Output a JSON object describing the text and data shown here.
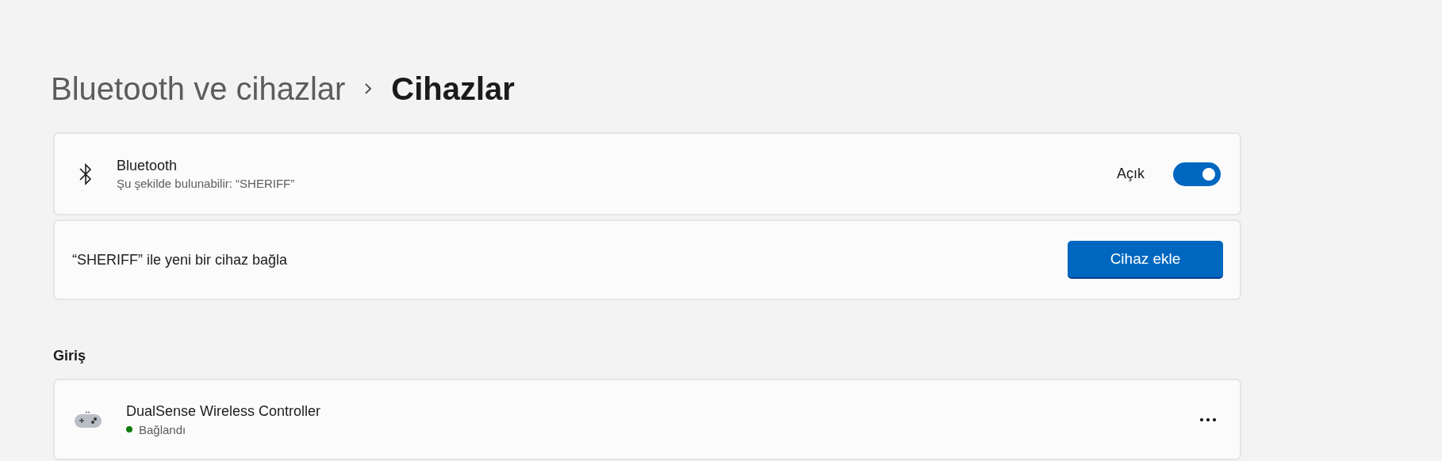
{
  "breadcrumb": [
    {
      "label": "Bluetooth ve cihazlar",
      "current": false
    },
    {
      "label": "Cihazlar",
      "current": true
    }
  ],
  "bluetooth": {
    "title": "Bluetooth",
    "subtitle": "Şu şekilde bulunabilir: “SHERIFF”",
    "state_label": "Açık",
    "on": true
  },
  "add_device": {
    "text": "“SHERIFF” ile yeni bir cihaz bağla",
    "button": "Cihaz ekle"
  },
  "sections": [
    {
      "title": "Giriş",
      "devices": [
        {
          "name": "DualSense Wireless Controller",
          "status": "Bağlandı",
          "connected": true
        }
      ]
    }
  ]
}
